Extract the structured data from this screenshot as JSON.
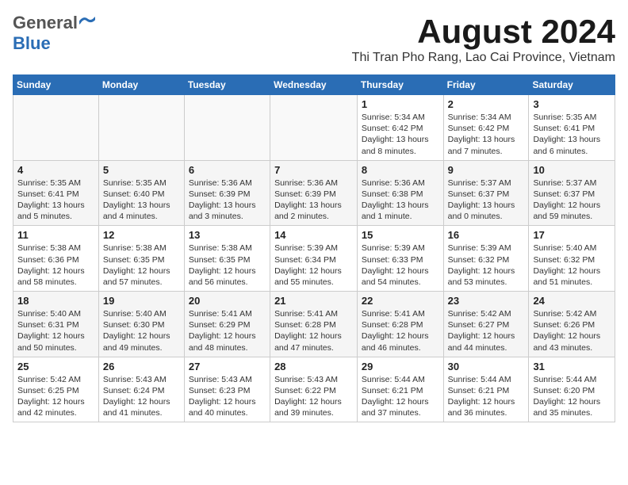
{
  "header": {
    "logo_general": "General",
    "logo_blue": "Blue",
    "month_title": "August 2024",
    "location": "Thi Tran Pho Rang, Lao Cai Province, Vietnam"
  },
  "days_of_week": [
    "Sunday",
    "Monday",
    "Tuesday",
    "Wednesday",
    "Thursday",
    "Friday",
    "Saturday"
  ],
  "weeks": [
    [
      {
        "day": "",
        "info": ""
      },
      {
        "day": "",
        "info": ""
      },
      {
        "day": "",
        "info": ""
      },
      {
        "day": "",
        "info": ""
      },
      {
        "day": "1",
        "info": "Sunrise: 5:34 AM\nSunset: 6:42 PM\nDaylight: 13 hours\nand 8 minutes."
      },
      {
        "day": "2",
        "info": "Sunrise: 5:34 AM\nSunset: 6:42 PM\nDaylight: 13 hours\nand 7 minutes."
      },
      {
        "day": "3",
        "info": "Sunrise: 5:35 AM\nSunset: 6:41 PM\nDaylight: 13 hours\nand 6 minutes."
      }
    ],
    [
      {
        "day": "4",
        "info": "Sunrise: 5:35 AM\nSunset: 6:41 PM\nDaylight: 13 hours\nand 5 minutes."
      },
      {
        "day": "5",
        "info": "Sunrise: 5:35 AM\nSunset: 6:40 PM\nDaylight: 13 hours\nand 4 minutes."
      },
      {
        "day": "6",
        "info": "Sunrise: 5:36 AM\nSunset: 6:39 PM\nDaylight: 13 hours\nand 3 minutes."
      },
      {
        "day": "7",
        "info": "Sunrise: 5:36 AM\nSunset: 6:39 PM\nDaylight: 13 hours\nand 2 minutes."
      },
      {
        "day": "8",
        "info": "Sunrise: 5:36 AM\nSunset: 6:38 PM\nDaylight: 13 hours\nand 1 minute."
      },
      {
        "day": "9",
        "info": "Sunrise: 5:37 AM\nSunset: 6:37 PM\nDaylight: 13 hours\nand 0 minutes."
      },
      {
        "day": "10",
        "info": "Sunrise: 5:37 AM\nSunset: 6:37 PM\nDaylight: 12 hours\nand 59 minutes."
      }
    ],
    [
      {
        "day": "11",
        "info": "Sunrise: 5:38 AM\nSunset: 6:36 PM\nDaylight: 12 hours\nand 58 minutes."
      },
      {
        "day": "12",
        "info": "Sunrise: 5:38 AM\nSunset: 6:35 PM\nDaylight: 12 hours\nand 57 minutes."
      },
      {
        "day": "13",
        "info": "Sunrise: 5:38 AM\nSunset: 6:35 PM\nDaylight: 12 hours\nand 56 minutes."
      },
      {
        "day": "14",
        "info": "Sunrise: 5:39 AM\nSunset: 6:34 PM\nDaylight: 12 hours\nand 55 minutes."
      },
      {
        "day": "15",
        "info": "Sunrise: 5:39 AM\nSunset: 6:33 PM\nDaylight: 12 hours\nand 54 minutes."
      },
      {
        "day": "16",
        "info": "Sunrise: 5:39 AM\nSunset: 6:32 PM\nDaylight: 12 hours\nand 53 minutes."
      },
      {
        "day": "17",
        "info": "Sunrise: 5:40 AM\nSunset: 6:32 PM\nDaylight: 12 hours\nand 51 minutes."
      }
    ],
    [
      {
        "day": "18",
        "info": "Sunrise: 5:40 AM\nSunset: 6:31 PM\nDaylight: 12 hours\nand 50 minutes."
      },
      {
        "day": "19",
        "info": "Sunrise: 5:40 AM\nSunset: 6:30 PM\nDaylight: 12 hours\nand 49 minutes."
      },
      {
        "day": "20",
        "info": "Sunrise: 5:41 AM\nSunset: 6:29 PM\nDaylight: 12 hours\nand 48 minutes."
      },
      {
        "day": "21",
        "info": "Sunrise: 5:41 AM\nSunset: 6:28 PM\nDaylight: 12 hours\nand 47 minutes."
      },
      {
        "day": "22",
        "info": "Sunrise: 5:41 AM\nSunset: 6:28 PM\nDaylight: 12 hours\nand 46 minutes."
      },
      {
        "day": "23",
        "info": "Sunrise: 5:42 AM\nSunset: 6:27 PM\nDaylight: 12 hours\nand 44 minutes."
      },
      {
        "day": "24",
        "info": "Sunrise: 5:42 AM\nSunset: 6:26 PM\nDaylight: 12 hours\nand 43 minutes."
      }
    ],
    [
      {
        "day": "25",
        "info": "Sunrise: 5:42 AM\nSunset: 6:25 PM\nDaylight: 12 hours\nand 42 minutes."
      },
      {
        "day": "26",
        "info": "Sunrise: 5:43 AM\nSunset: 6:24 PM\nDaylight: 12 hours\nand 41 minutes."
      },
      {
        "day": "27",
        "info": "Sunrise: 5:43 AM\nSunset: 6:23 PM\nDaylight: 12 hours\nand 40 minutes."
      },
      {
        "day": "28",
        "info": "Sunrise: 5:43 AM\nSunset: 6:22 PM\nDaylight: 12 hours\nand 39 minutes."
      },
      {
        "day": "29",
        "info": "Sunrise: 5:44 AM\nSunset: 6:21 PM\nDaylight: 12 hours\nand 37 minutes."
      },
      {
        "day": "30",
        "info": "Sunrise: 5:44 AM\nSunset: 6:21 PM\nDaylight: 12 hours\nand 36 minutes."
      },
      {
        "day": "31",
        "info": "Sunrise: 5:44 AM\nSunset: 6:20 PM\nDaylight: 12 hours\nand 35 minutes."
      }
    ]
  ]
}
